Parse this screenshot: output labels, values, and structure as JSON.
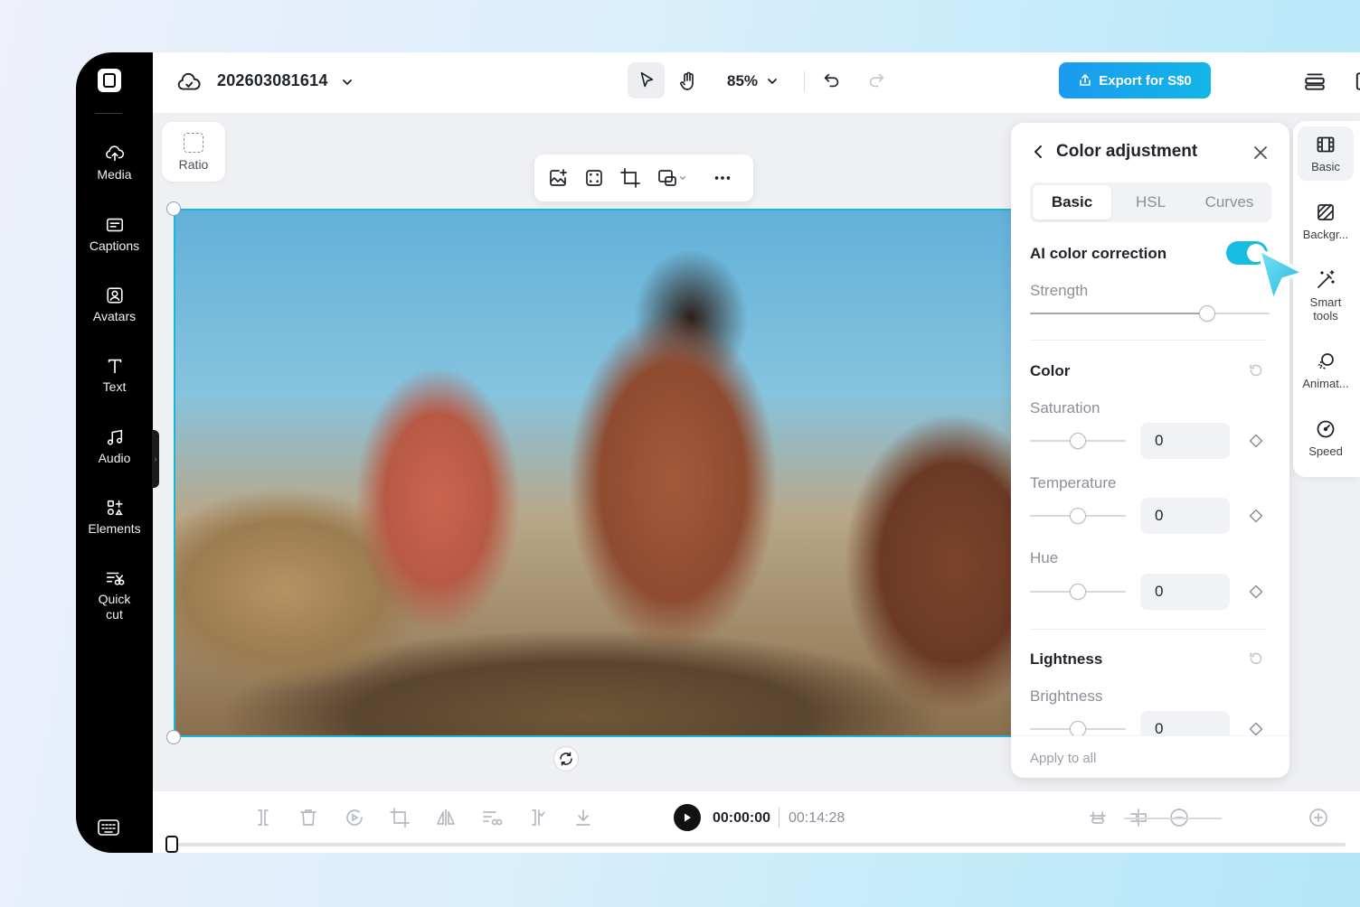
{
  "project": {
    "title": "202603081614"
  },
  "sidebar": {
    "items": [
      {
        "label": "Media",
        "icon": "cloud-upload-icon"
      },
      {
        "label": "Captions",
        "icon": "captions-icon"
      },
      {
        "label": "Avatars",
        "icon": "avatar-icon"
      },
      {
        "label": "Text",
        "icon": "text-icon"
      },
      {
        "label": "Audio",
        "icon": "music-note-icon"
      },
      {
        "label": "Elements",
        "icon": "elements-icon"
      },
      {
        "label": "Quick cut",
        "icon": "quick-cut-icon"
      }
    ]
  },
  "toolbar": {
    "zoom": "85%",
    "export_label": "Export for S$0"
  },
  "canvas": {
    "ratio_label": "Ratio"
  },
  "color_panel": {
    "title": "Color adjustment",
    "tabs": [
      {
        "label": "Basic",
        "active": true
      },
      {
        "label": "HSL",
        "active": false
      },
      {
        "label": "Curves",
        "active": false
      }
    ],
    "ai_correction": {
      "label": "AI color correction",
      "enabled": true
    },
    "strength": {
      "label": "Strength",
      "level": 0.74
    },
    "color_section": {
      "title": "Color",
      "sliders": [
        {
          "label": "Saturation",
          "value": "0",
          "level": 0.5
        },
        {
          "label": "Temperature",
          "value": "0",
          "level": 0.5
        },
        {
          "label": "Hue",
          "value": "0",
          "level": 0.5
        }
      ]
    },
    "lightness_section": {
      "title": "Lightness",
      "sliders": [
        {
          "label": "Brightness",
          "value": "0",
          "level": 0.5
        }
      ]
    },
    "apply_all": "Apply to all"
  },
  "right_rail": {
    "items": [
      {
        "label": "Basic",
        "icon": "film-icon",
        "active": true
      },
      {
        "label": "Backgr...",
        "icon": "background-icon"
      },
      {
        "label": "Smart tools",
        "icon": "magic-wand-icon"
      },
      {
        "label": "Animat...",
        "icon": "animation-icon"
      },
      {
        "label": "Speed",
        "icon": "speed-icon"
      }
    ]
  },
  "playback": {
    "current": "00:00:00",
    "total": "00:14:28"
  },
  "colors": {
    "accent": "#16bde0",
    "export": "#1a9bf0",
    "sidebar": "#000000"
  }
}
